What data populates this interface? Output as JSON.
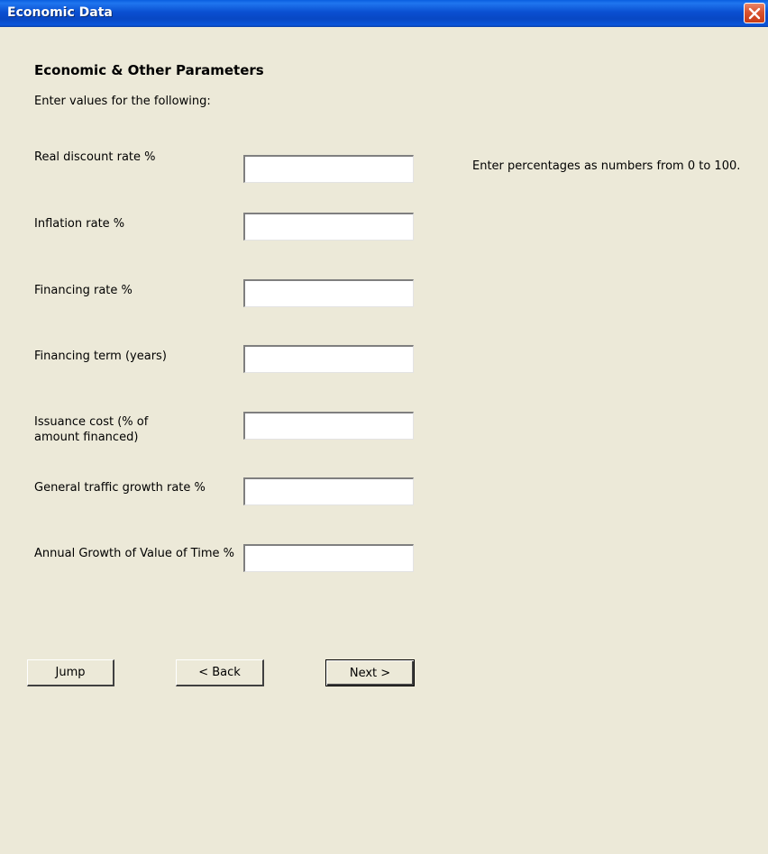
{
  "window": {
    "title": "Economic Data"
  },
  "form": {
    "heading": "Economic & Other Parameters",
    "subheading": "Enter values for the following:",
    "hint": "Enter percentages as numbers from 0 to 100.",
    "fields": [
      {
        "label": "Real discount rate %",
        "value": ""
      },
      {
        "label": "Inflation rate %",
        "value": ""
      },
      {
        "label": "Financing rate %",
        "value": ""
      },
      {
        "label": "Financing term (years)",
        "value": ""
      },
      {
        "label": "Issuance cost (% of amount financed)",
        "value": ""
      },
      {
        "label": "General traffic growth rate %",
        "value": ""
      },
      {
        "label": "Annual Growth of Value of Time %",
        "value": ""
      }
    ]
  },
  "buttons": {
    "jump": "Jump",
    "back": "< Back",
    "next": "Next >"
  },
  "icons": {
    "close": "close-icon"
  },
  "colors": {
    "titlebar": "#0a4fd1",
    "close_button": "#d9532f",
    "background": "#ece9d8"
  }
}
